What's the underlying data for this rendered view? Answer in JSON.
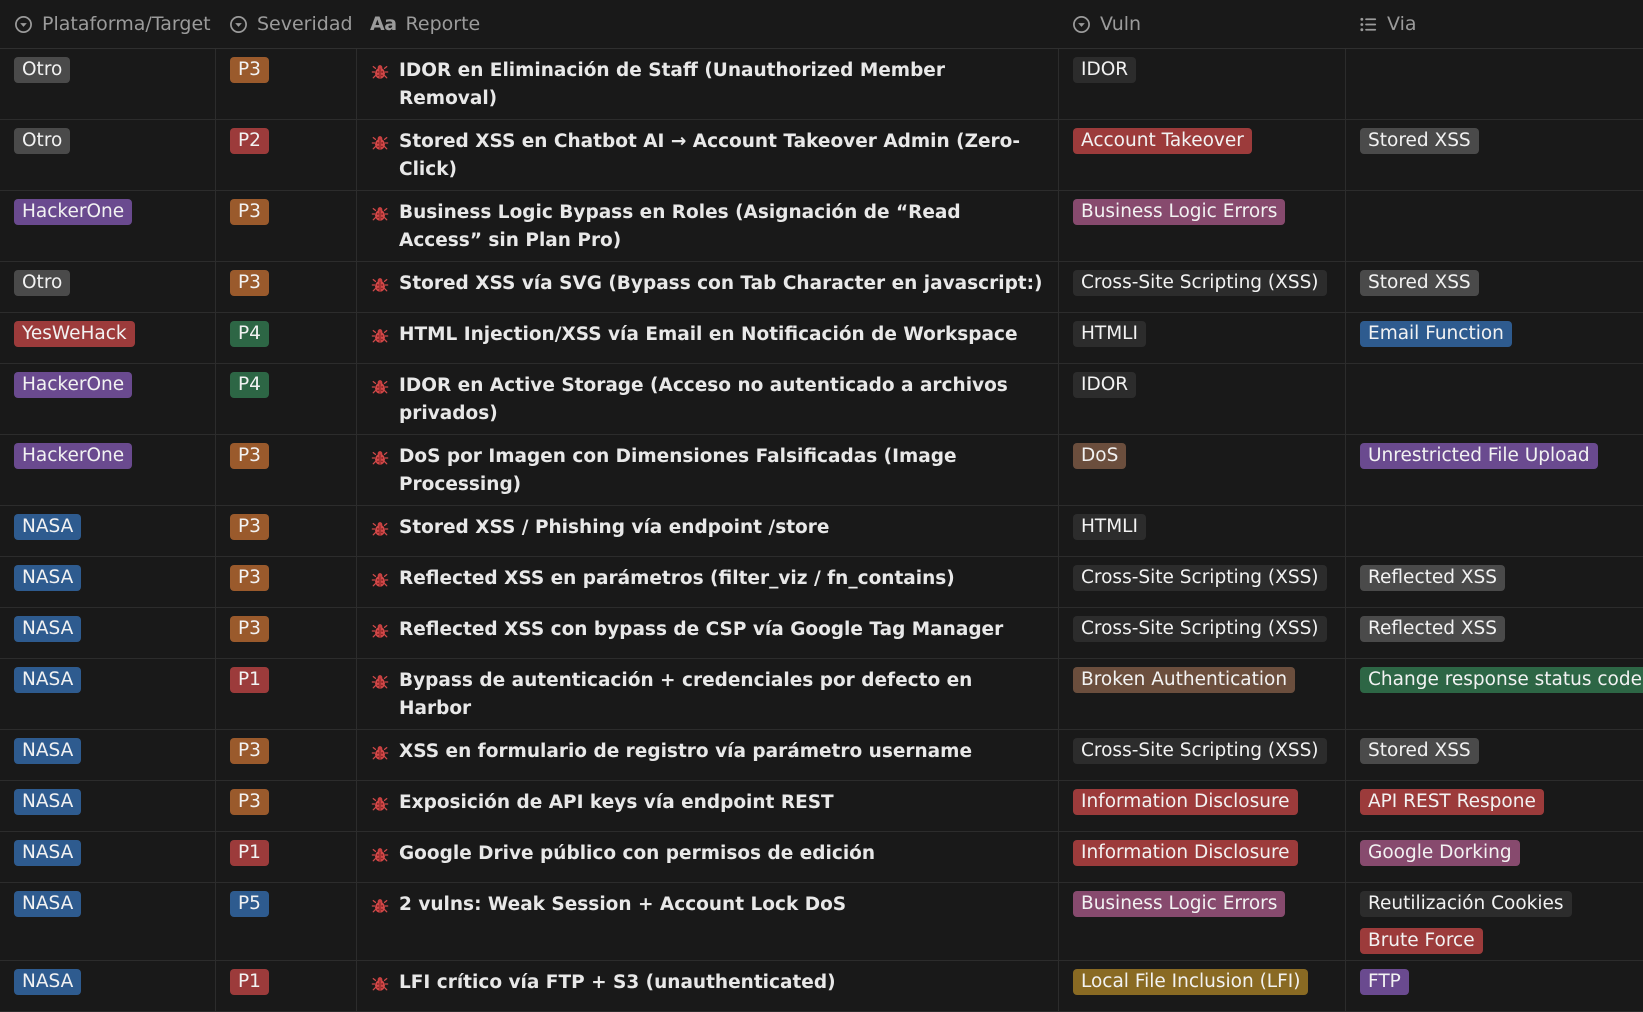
{
  "columns": {
    "platform": "Plataforma/Target",
    "severity": "Severidad",
    "report": "Reporte",
    "report_icon": "Aa",
    "vuln": "Vuln",
    "via": "Via"
  },
  "colors": {
    "gray": "#4a4a4a",
    "brown": "#6b4e3d",
    "orange": "#9a5a2c",
    "yellow": "#896a23",
    "green": "#2d6645",
    "blue": "#2e5b8f",
    "purple": "#6a4a8f",
    "pink": "#874a6e",
    "red": "#9c3b3b"
  },
  "rows": [
    {
      "platform": {
        "label": "Otro",
        "color": "gray"
      },
      "severity": {
        "label": "P3",
        "color": "orange"
      },
      "report": "IDOR en Eliminación de Staff (Unauthorized Member Removal)",
      "vuln": [
        {
          "label": "IDOR",
          "color": "dark"
        }
      ],
      "via": []
    },
    {
      "platform": {
        "label": "Otro",
        "color": "gray"
      },
      "severity": {
        "label": "P2",
        "color": "red"
      },
      "report": "Stored XSS en Chatbot AI → Account Takeover Admin (Zero-Click)",
      "vuln": [
        {
          "label": "Account Takeover",
          "color": "red"
        }
      ],
      "via": [
        {
          "label": "Stored XSS",
          "color": "gray"
        }
      ]
    },
    {
      "platform": {
        "label": "HackerOne",
        "color": "purple"
      },
      "severity": {
        "label": "P3",
        "color": "orange"
      },
      "report": "Business Logic Bypass en Roles (Asignación de “Read Access” sin Plan Pro)",
      "vuln": [
        {
          "label": "Business Logic Errors",
          "color": "pink"
        }
      ],
      "via": []
    },
    {
      "platform": {
        "label": "Otro",
        "color": "gray"
      },
      "severity": {
        "label": "P3",
        "color": "orange"
      },
      "report": "Stored XSS vía SVG (Bypass con Tab Character en javascript:)",
      "vuln": [
        {
          "label": "Cross-Site Scripting (XSS)",
          "color": "dark"
        }
      ],
      "via": [
        {
          "label": "Stored XSS",
          "color": "gray"
        }
      ]
    },
    {
      "platform": {
        "label": "YesWeHack",
        "color": "red"
      },
      "severity": {
        "label": "P4",
        "color": "green"
      },
      "report": "HTML Injection/XSS vía Email en Notificación de Workspace",
      "vuln": [
        {
          "label": "HTMLI",
          "color": "dark"
        }
      ],
      "via": [
        {
          "label": "Email Function",
          "color": "blue"
        }
      ]
    },
    {
      "platform": {
        "label": "HackerOne",
        "color": "purple"
      },
      "severity": {
        "label": "P4",
        "color": "green"
      },
      "report": "IDOR en Active Storage (Acceso no autenticado a archivos privados)",
      "vuln": [
        {
          "label": "IDOR",
          "color": "dark"
        }
      ],
      "via": []
    },
    {
      "platform": {
        "label": "HackerOne",
        "color": "purple"
      },
      "severity": {
        "label": "P3",
        "color": "orange"
      },
      "report": "DoS por Imagen con Dimensiones Falsificadas (Image Processing)",
      "vuln": [
        {
          "label": "DoS",
          "color": "brown"
        }
      ],
      "via": [
        {
          "label": "Unrestricted File Upload",
          "color": "purple"
        }
      ]
    },
    {
      "platform": {
        "label": "NASA",
        "color": "blue"
      },
      "severity": {
        "label": "P3",
        "color": "orange"
      },
      "report": "Stored XSS / Phishing vía endpoint /store",
      "vuln": [
        {
          "label": "HTMLI",
          "color": "dark"
        }
      ],
      "via": []
    },
    {
      "platform": {
        "label": "NASA",
        "color": "blue"
      },
      "severity": {
        "label": "P3",
        "color": "orange"
      },
      "report": "Reflected XSS en parámetros (filter_viz / fn_contains)",
      "vuln": [
        {
          "label": "Cross-Site Scripting (XSS)",
          "color": "dark"
        }
      ],
      "via": [
        {
          "label": "Reflected XSS",
          "color": "gray"
        }
      ]
    },
    {
      "platform": {
        "label": "NASA",
        "color": "blue"
      },
      "severity": {
        "label": "P3",
        "color": "orange"
      },
      "report": "Reflected XSS con bypass de CSP vía Google Tag Manager",
      "vuln": [
        {
          "label": "Cross-Site Scripting (XSS)",
          "color": "dark"
        }
      ],
      "via": [
        {
          "label": "Reflected XSS",
          "color": "gray"
        }
      ]
    },
    {
      "platform": {
        "label": "NASA",
        "color": "blue"
      },
      "severity": {
        "label": "P1",
        "color": "red"
      },
      "report": "Bypass de autenticación + credenciales por defecto en Harbor",
      "vuln": [
        {
          "label": "Broken Authentication",
          "color": "brown"
        }
      ],
      "via": [
        {
          "label": "Change response status code",
          "color": "green"
        }
      ]
    },
    {
      "platform": {
        "label": "NASA",
        "color": "blue"
      },
      "severity": {
        "label": "P3",
        "color": "orange"
      },
      "report": "XSS en formulario de registro vía parámetro username",
      "vuln": [
        {
          "label": "Cross-Site Scripting (XSS)",
          "color": "dark"
        }
      ],
      "via": [
        {
          "label": "Stored XSS",
          "color": "gray"
        }
      ]
    },
    {
      "platform": {
        "label": "NASA",
        "color": "blue"
      },
      "severity": {
        "label": "P3",
        "color": "orange"
      },
      "report": "Exposición de API keys vía endpoint REST",
      "vuln": [
        {
          "label": "Information Disclosure",
          "color": "red"
        }
      ],
      "via": [
        {
          "label": "API REST Respone",
          "color": "red"
        }
      ]
    },
    {
      "platform": {
        "label": "NASA",
        "color": "blue"
      },
      "severity": {
        "label": "P1",
        "color": "red"
      },
      "report": "Google Drive público con permisos de edición",
      "vuln": [
        {
          "label": "Information Disclosure",
          "color": "red"
        }
      ],
      "via": [
        {
          "label": "Google Dorking",
          "color": "pink"
        }
      ]
    },
    {
      "platform": {
        "label": "NASA",
        "color": "blue"
      },
      "severity": {
        "label": "P5",
        "color": "blue"
      },
      "report": "2 vulns: Weak Session + Account Lock DoS",
      "vuln": [
        {
          "label": "Business Logic Errors",
          "color": "pink"
        }
      ],
      "via": [
        {
          "label": "Reutilización Cookies",
          "color": "dark"
        },
        {
          "label": "Brute Force",
          "color": "red"
        }
      ]
    },
    {
      "platform": {
        "label": "NASA",
        "color": "blue"
      },
      "severity": {
        "label": "P1",
        "color": "red"
      },
      "report": "LFI crítico vía FTP + S3 (unauthenticated)",
      "vuln": [
        {
          "label": "Local File Inclusion (LFI)",
          "color": "yellow"
        }
      ],
      "via": [
        {
          "label": "FTP",
          "color": "purple"
        }
      ]
    }
  ]
}
